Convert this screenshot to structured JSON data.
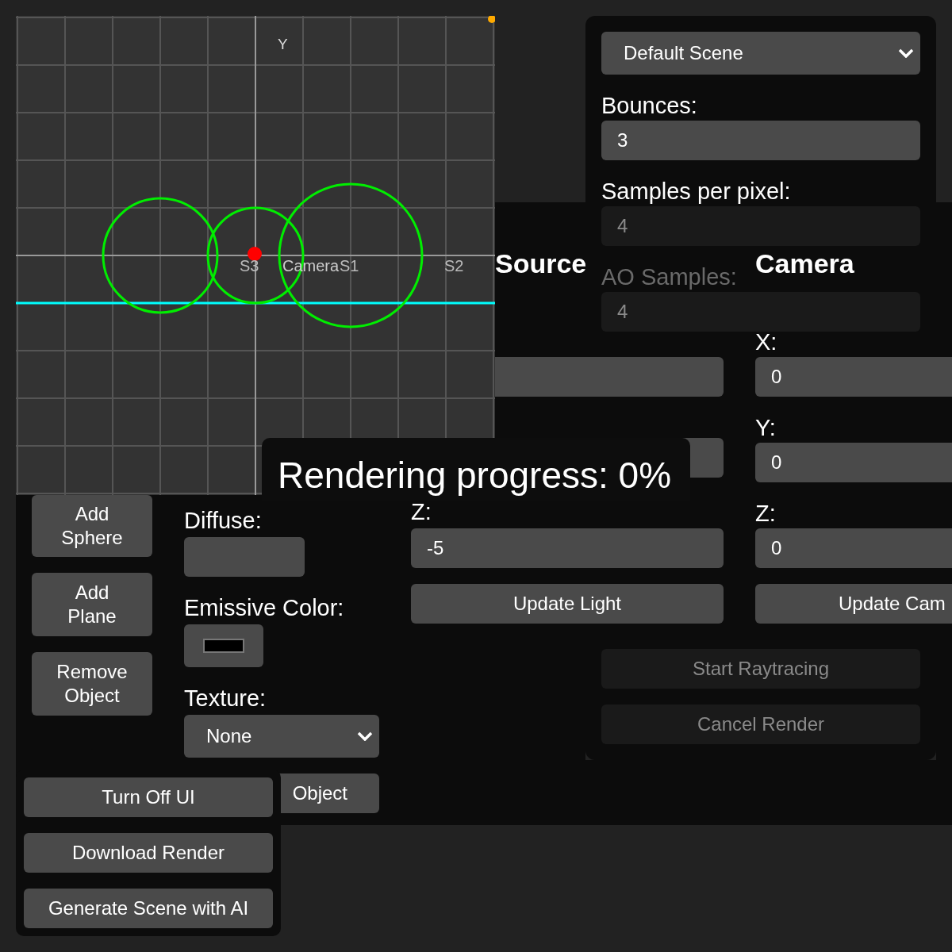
{
  "scene_preview": {
    "axis_label": "Y",
    "labels": [
      {
        "text": "S3",
        "kind": "sphere"
      },
      {
        "text": "Camera",
        "kind": "camera"
      },
      {
        "text": "S1",
        "kind": "sphere"
      },
      {
        "text": "S2",
        "kind": "sphere"
      }
    ]
  },
  "render_settings": {
    "scene": "Default Scene",
    "bounces": {
      "label": "Bounces:",
      "value": "3"
    },
    "samples": {
      "label": "Samples per pixel:",
      "value": "4"
    },
    "ao_samples": {
      "label": "AO Samples:",
      "value": "4"
    },
    "buttons": [
      "Start Raytracing",
      "Cancel Render"
    ]
  },
  "object_editor": {
    "buttons": [
      "Add Sphere",
      "Add Plane",
      "Remove Object"
    ],
    "diffuse_label": "Diffuse:",
    "emissive_label": "Emissive Color:",
    "texture_label": "Texture:",
    "texture": "None",
    "update_button": "Object"
  },
  "light": {
    "heading": "Source",
    "z_label": "Z:",
    "z_value": "-5",
    "button": "Update Light"
  },
  "camera": {
    "heading": "Camera",
    "fields": [
      {
        "label": "X:",
        "value": "0"
      },
      {
        "label": "Y:",
        "value": "0"
      },
      {
        "label": "Z:",
        "value": "0"
      }
    ],
    "button": "Update Cam"
  },
  "progress": "Rendering progress: 0%",
  "bottom_buttons": [
    "Turn Off UI",
    "Download Render",
    "Generate Scene with AI"
  ]
}
